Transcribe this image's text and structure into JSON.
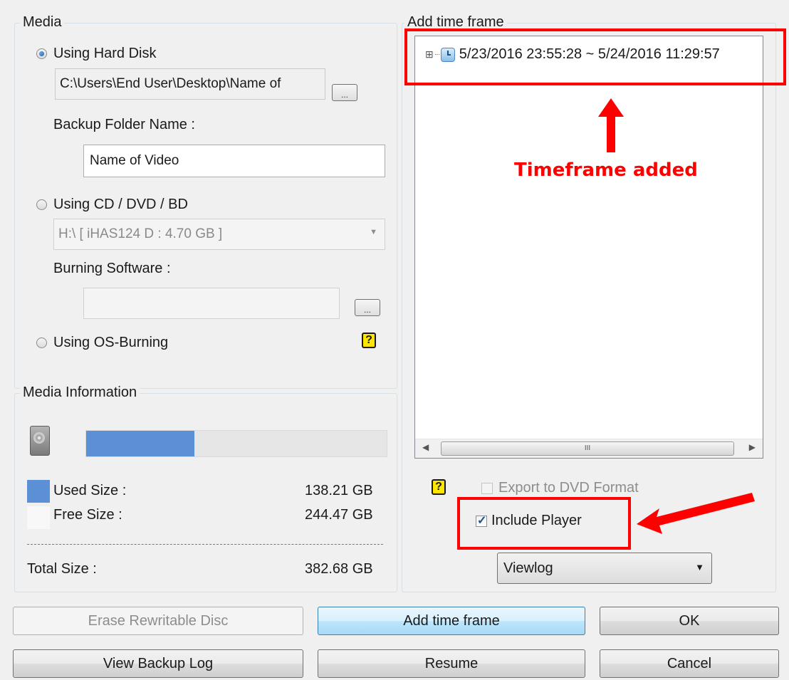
{
  "media": {
    "legend": "Media",
    "hard_disk": {
      "label": "Using Hard Disk",
      "path": "C:\\Users\\End User\\Desktop\\Name of",
      "browse_label": "...",
      "folder_label": "Backup Folder Name :",
      "folder_value": "Name of Video"
    },
    "cd_dvd": {
      "label": "Using CD / DVD / BD",
      "drive_value": "H:\\ [ iHAS124   D     : 4.70 GB ]",
      "software_label": "Burning Software :",
      "software_value": "",
      "browse_label": "..."
    },
    "os_burning": {
      "label": "Using OS-Burning"
    }
  },
  "media_info": {
    "legend": "Media Information",
    "used_fraction": 0.361,
    "used_label": "Used Size :",
    "used_value": "138.21 GB",
    "free_label": "Free Size :",
    "free_value": "244.47 GB",
    "total_label": "Total Size :",
    "total_value": "382.68 GB",
    "used_color": "#5b8fd6"
  },
  "time_frame": {
    "legend": "Add time frame",
    "items": [
      {
        "expander": "⊞",
        "text": "5/23/2016 23:55:28 ~ 5/24/2016 11:29:57"
      }
    ],
    "scroll_thumb_glyph": "III"
  },
  "options": {
    "help_glyph": "?",
    "export_dvd_label": "Export to DVD Format",
    "include_player_label": "Include Player",
    "player_select": "Viewlog"
  },
  "buttons": {
    "erase": "Erase Rewritable Disc",
    "add_time_frame": "Add time frame",
    "ok": "OK",
    "view_log": "View Backup Log",
    "resume": "Resume",
    "cancel": "Cancel"
  },
  "annotation": {
    "text": "Timeframe added",
    "color": "#ff0000"
  }
}
